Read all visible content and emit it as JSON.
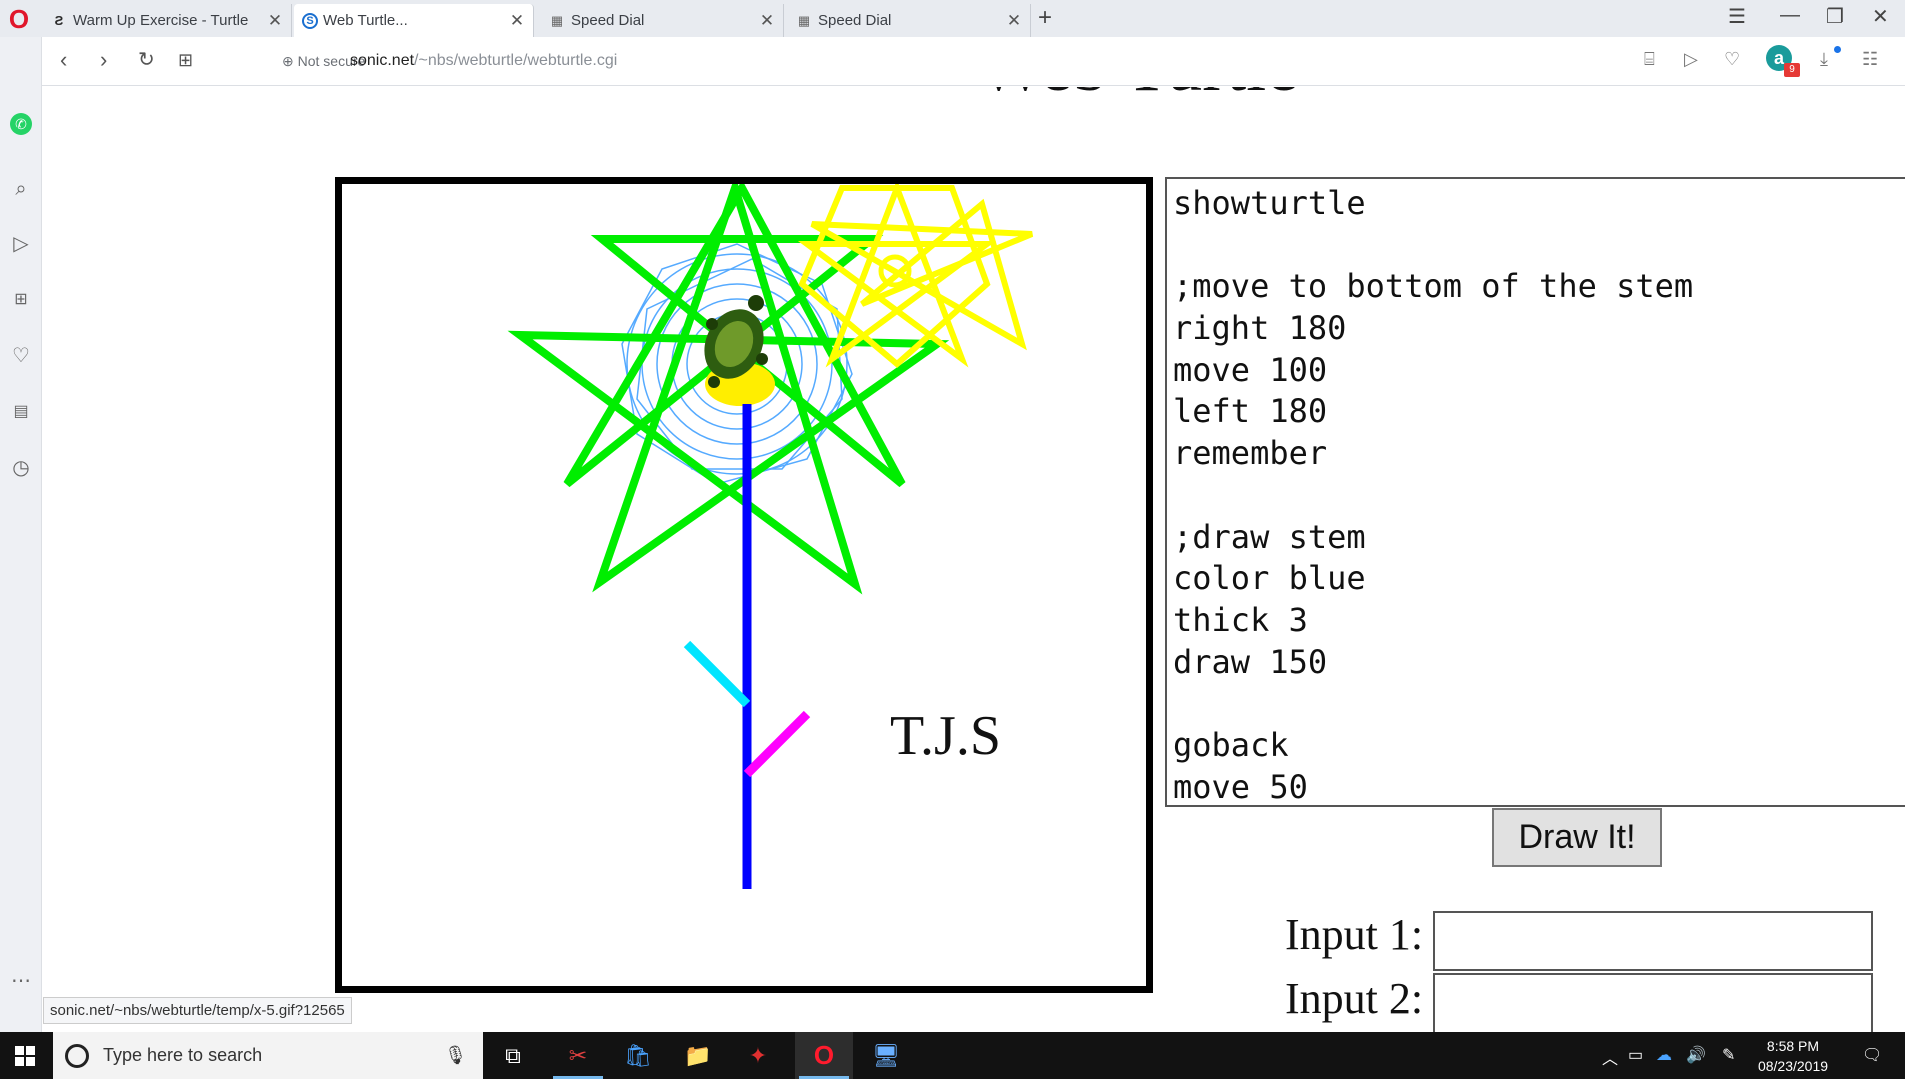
{
  "tabs": [
    {
      "title": "Warm Up Exercise - Turtle",
      "icon": "sc-logo-icon"
    },
    {
      "title": "Web Turtle...",
      "icon": "s-logo-icon"
    },
    {
      "title": "Speed Dial",
      "icon": "speed-dial-icon"
    },
    {
      "title": "Speed Dial",
      "icon": "speed-dial-icon"
    }
  ],
  "address": {
    "security": "Not secure",
    "host": "sonic.net",
    "path": "/~nbs/webturtle/webturtle.cgi"
  },
  "badge_count": "9",
  "page": {
    "heading": "Web Turtle",
    "signature": "T.J.S",
    "program_lines": [
      "showturtle",
      "",
      ";move to bottom of the stem",
      "right 180",
      "move 100",
      "left 180",
      "remember",
      "",
      ";draw stem",
      "color blue",
      "thick 3",
      "draw 150",
      "",
      "goback",
      "move 50"
    ],
    "draw_button": "Draw It!",
    "input1_label": "Input 1:",
    "input2_label": "Input 2:"
  },
  "status_url": "sonic.net/~nbs/webturtle/temp/x-5.gif?12565",
  "taskbar": {
    "search_placeholder": "Type here to search",
    "time": "8:58 PM",
    "date": "08/23/2019"
  },
  "colors": {
    "opera_red": "#e0162b",
    "stem": "#0000ff",
    "leaf_left": "#00e5ff",
    "leaf_right": "#ff00ff",
    "petals": "#00ff00",
    "sun": "#ffff00",
    "web": "#55aaff"
  }
}
